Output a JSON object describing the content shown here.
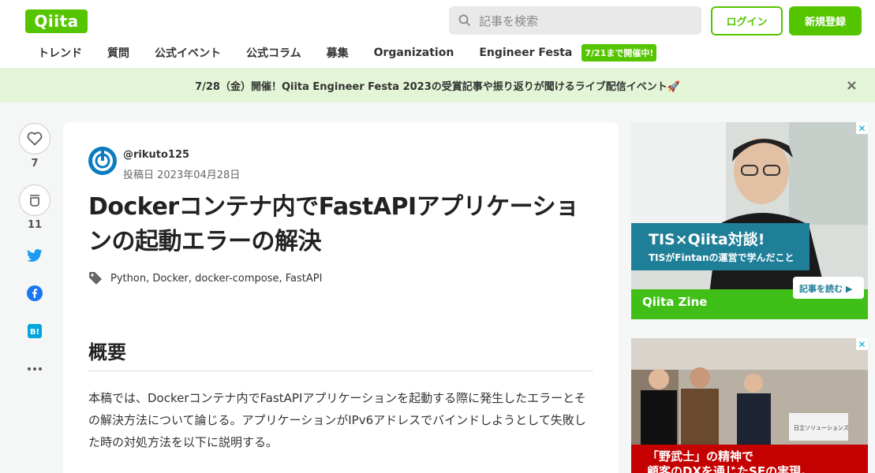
{
  "header": {
    "logo": "Qiita",
    "search_placeholder": "記事を検索",
    "login": "ログイン",
    "signup": "新規登録"
  },
  "nav": {
    "items": [
      "トレンド",
      "質問",
      "公式イベント",
      "公式コラム",
      "募集",
      "Organization",
      "Engineer Festa"
    ],
    "festa_badge": "7/21まで開催中!"
  },
  "banner": {
    "text": "7/28（金）開催！Qiita Engineer Festa 2023の受賞記事や振り返りが聞けるライブ配信イベント🚀",
    "close": "×"
  },
  "actions": {
    "like_count": "7",
    "stock_count": "11"
  },
  "article": {
    "user": "@rikuto125",
    "posted": "投稿日 2023年04月28日",
    "title": "Dockerコンテナ内でFastAPIアプリケーションの起動エラーの解決",
    "tags": [
      "Python",
      "Docker",
      "docker-compose",
      "FastAPI"
    ],
    "heading": "概要",
    "body": "本稿では、Dockerコンテナ内でFastAPIアプリケーションを起動する際に発生したエラーとその解決方法について論じる。アプリケーションがIPv6アドレスでバインドしようとして失敗した時の対処方法を以下に説明する。"
  },
  "ads": {
    "ad1": {
      "title": "TIS×Qiita対談!",
      "subtitle": "TISがFintanの運営で学んだこと",
      "cta": "記事を読む ▶",
      "brand": "Qiita Zine"
    },
    "ad2": {
      "sign": "日立ソリューションズ",
      "line1": "「野武士」の精神で",
      "line2": "顧客のDXを通じたSEの実現。"
    }
  }
}
